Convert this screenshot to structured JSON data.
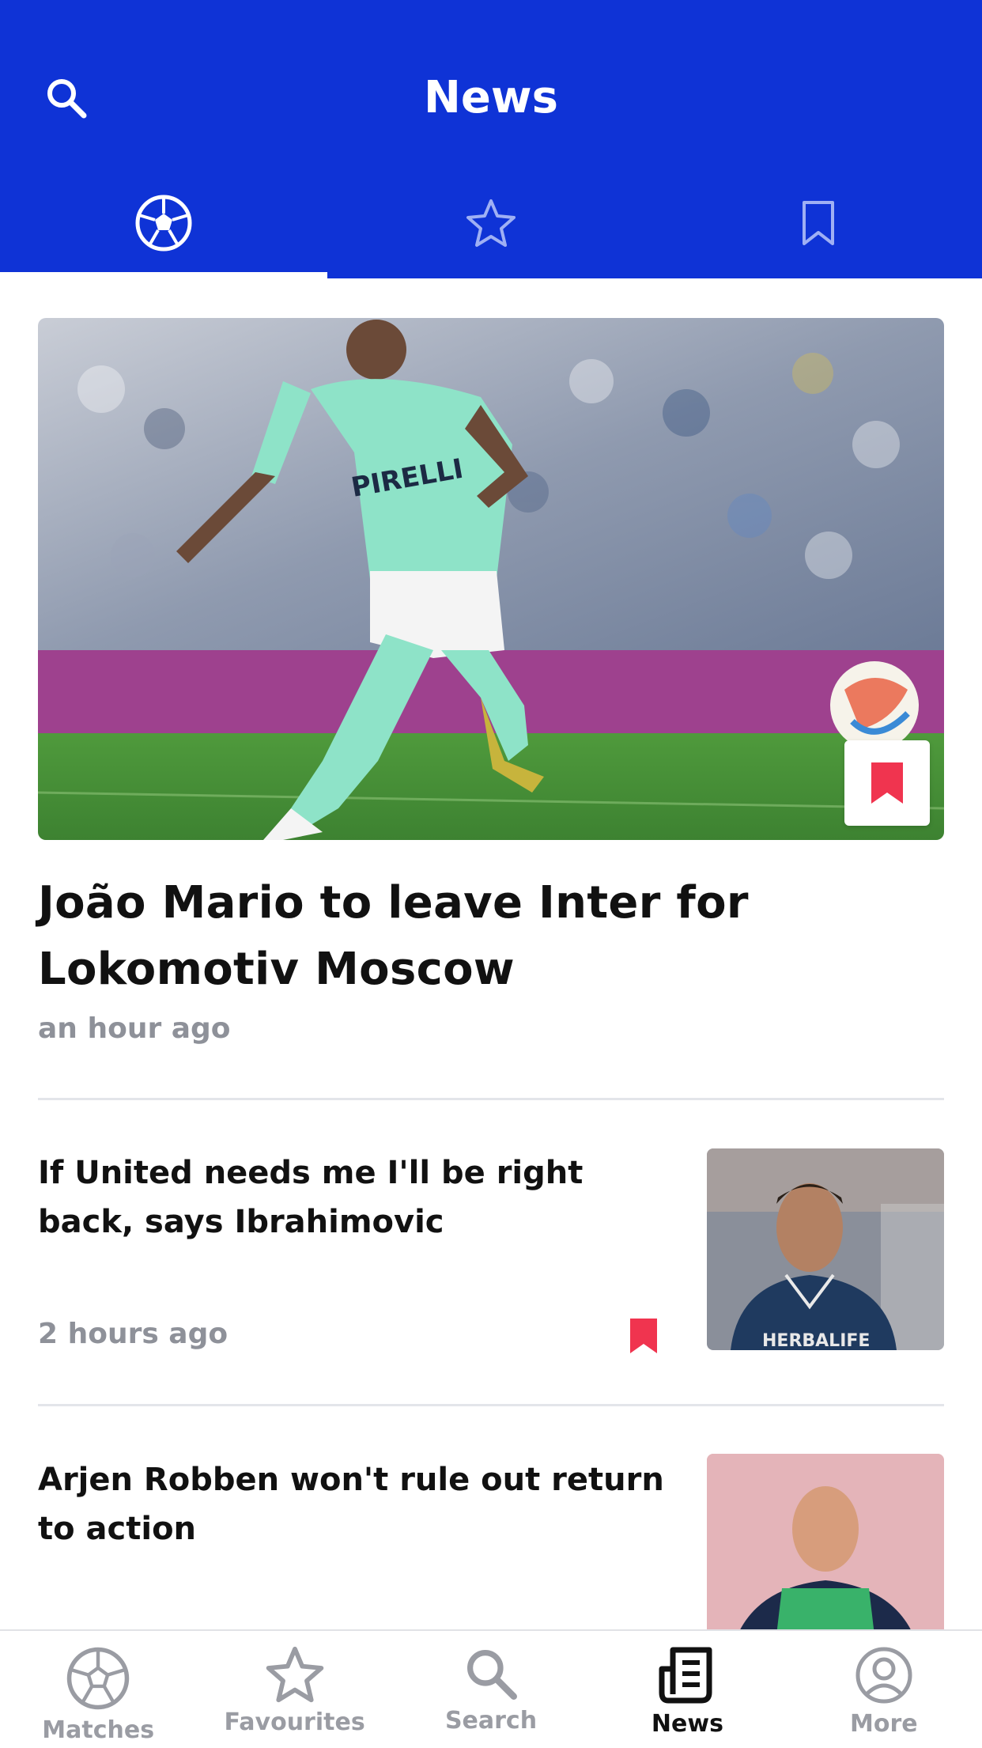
{
  "header": {
    "title": "News",
    "search_icon": "search-icon",
    "background": "#0F33D6"
  },
  "tabs": [
    {
      "name": "tab-football",
      "icon": "football-icon",
      "active": true
    },
    {
      "name": "tab-favourites",
      "icon": "star-icon",
      "active": false
    },
    {
      "name": "tab-saved",
      "icon": "bookmark-icon",
      "active": false
    }
  ],
  "featured": {
    "title": "João Mario to leave Inter for Lokomotiv Moscow",
    "time": "an hour ago",
    "bookmarked": true
  },
  "articles": [
    {
      "title": "If United needs me I'll be right back, says Ibrahimovic",
      "time": "2 hours ago",
      "bookmarked": true,
      "thumb_text": "HERBALIFE"
    },
    {
      "title": "Arjen Robben won't rule out return to action",
      "time": "",
      "bookmarked": false
    }
  ],
  "bottom_nav": [
    {
      "label": "Matches",
      "icon": "football-icon",
      "active": false
    },
    {
      "label": "Favourites",
      "icon": "star-icon",
      "active": false
    },
    {
      "label": "Search",
      "icon": "search-icon",
      "active": false
    },
    {
      "label": "News",
      "icon": "news-icon",
      "active": true
    },
    {
      "label": "More",
      "icon": "profile-icon",
      "active": false
    }
  ],
  "colors": {
    "accent": "#0F33D6",
    "bookmark": "#F0344F",
    "meta": "#8E9199"
  }
}
